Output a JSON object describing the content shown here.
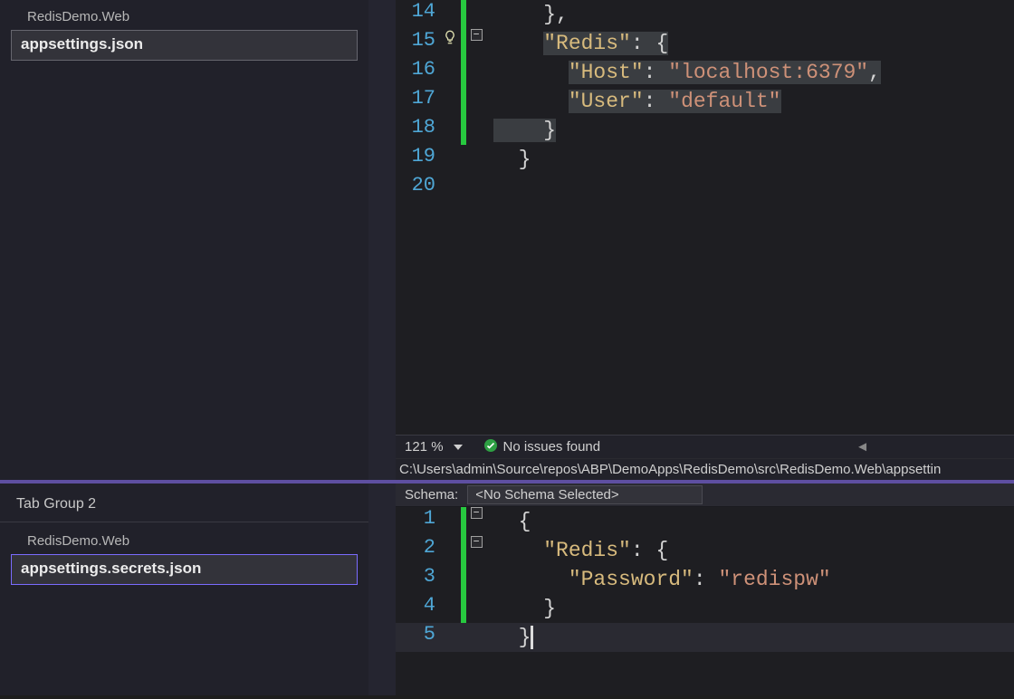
{
  "sidebar_top": {
    "project": "RedisDemo.Web",
    "file": "appsettings.json"
  },
  "sidebar_bottom": {
    "group_label": "Tab Group 2",
    "project": "RedisDemo.Web",
    "file": "appsettings.secrets.json"
  },
  "editor_top": {
    "zoom": "121 %",
    "issues_text": "No issues found",
    "path": "C:\\Users\\admin\\Source\\repos\\ABP\\DemoApps\\RedisDemo\\src\\RedisDemo.Web\\appsettin",
    "lines": {
      "l14": {
        "num": "14",
        "tokens": [
          [
            "    },",
            "brace"
          ]
        ]
      },
      "l15": {
        "num": "15",
        "tokens": [
          [
            "    ",
            "plain"
          ],
          [
            "\"Redis\"",
            "key"
          ],
          [
            ": ",
            "punc"
          ],
          [
            "{",
            "brace"
          ]
        ]
      },
      "l16": {
        "num": "16",
        "tokens": [
          [
            "      ",
            "plain"
          ],
          [
            "\"Host\"",
            "key"
          ],
          [
            ": ",
            "punc"
          ],
          [
            "\"localhost:6379\"",
            "str"
          ],
          [
            ",",
            "punc"
          ]
        ]
      },
      "l17": {
        "num": "17",
        "tokens": [
          [
            "      ",
            "plain"
          ],
          [
            "\"User\"",
            "key"
          ],
          [
            ": ",
            "punc"
          ],
          [
            "\"default\"",
            "str"
          ]
        ]
      },
      "l18": {
        "num": "18",
        "tokens": [
          [
            "    }",
            "brace"
          ]
        ]
      },
      "l19": {
        "num": "19",
        "tokens": [
          [
            "  }",
            "brace"
          ]
        ]
      },
      "l20": {
        "num": "20",
        "tokens": [
          [
            "",
            ""
          ]
        ]
      }
    }
  },
  "editor_bottom": {
    "schema_label": "Schema:",
    "schema_value": "<No Schema Selected>",
    "lines": {
      "l1": {
        "num": "1",
        "tokens": [
          [
            "  {",
            "brace"
          ]
        ]
      },
      "l2": {
        "num": "2",
        "tokens": [
          [
            "    ",
            "plain"
          ],
          [
            "\"Redis\"",
            "key"
          ],
          [
            ": ",
            "punc"
          ],
          [
            "{",
            "brace"
          ]
        ]
      },
      "l3": {
        "num": "3",
        "tokens": [
          [
            "      ",
            "plain"
          ],
          [
            "\"Password\"",
            "key"
          ],
          [
            ": ",
            "punc"
          ],
          [
            "\"redispw\"",
            "str"
          ]
        ]
      },
      "l4": {
        "num": "4",
        "tokens": [
          [
            "    }",
            "brace"
          ]
        ]
      },
      "l5": {
        "num": "5",
        "tokens": [
          [
            "  }",
            "brace"
          ]
        ]
      }
    }
  },
  "icons": {
    "bulb": "lightbulb-icon",
    "fold_minus": "−",
    "chevron_down": "chevron-down-icon",
    "check": "check-circle-icon",
    "scroll_left": "scroll-left-icon"
  }
}
